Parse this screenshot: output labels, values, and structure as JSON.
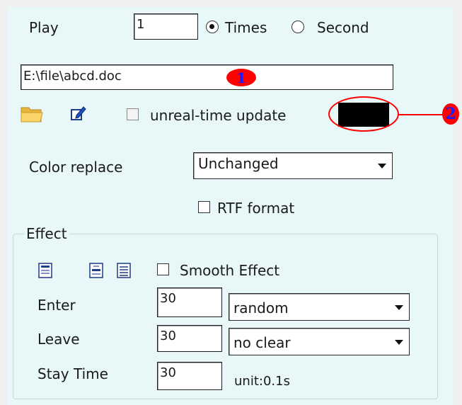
{
  "play": {
    "label": "Play",
    "count_value": "1",
    "mode_options": [
      {
        "label": "Times",
        "selected": true
      },
      {
        "label": "Second",
        "selected": false
      }
    ]
  },
  "file": {
    "path_value": "E:\\file\\abcd.doc",
    "folder_icon": "folder-icon",
    "edit_icon": "pencil-edit-icon"
  },
  "unreal_time_update": {
    "label": "unreal-time update",
    "checked": false
  },
  "color_swatch": "#000000",
  "color_replace": {
    "label": "Color replace",
    "selected": "Unchanged"
  },
  "rtf_format": {
    "label": "RTF format",
    "checked": false
  },
  "effect": {
    "title": "Effect",
    "icons": [
      "align-top-icon",
      "align-center-icon",
      "list-icon"
    ],
    "smooth_effect": {
      "label": "Smooth Effect",
      "checked": false
    },
    "enter": {
      "label": "Enter",
      "value": "30",
      "selected": "random"
    },
    "leave": {
      "label": "Leave",
      "value": "30",
      "selected": "no clear"
    },
    "stay_time": {
      "label": "Stay Time",
      "value": "30",
      "unit": "unit:0.1s"
    }
  },
  "annotations": {
    "marker_1": "1",
    "marker_2": "2",
    "marker_color": "#ff0000",
    "marker_text_color": "#1b1bff"
  }
}
